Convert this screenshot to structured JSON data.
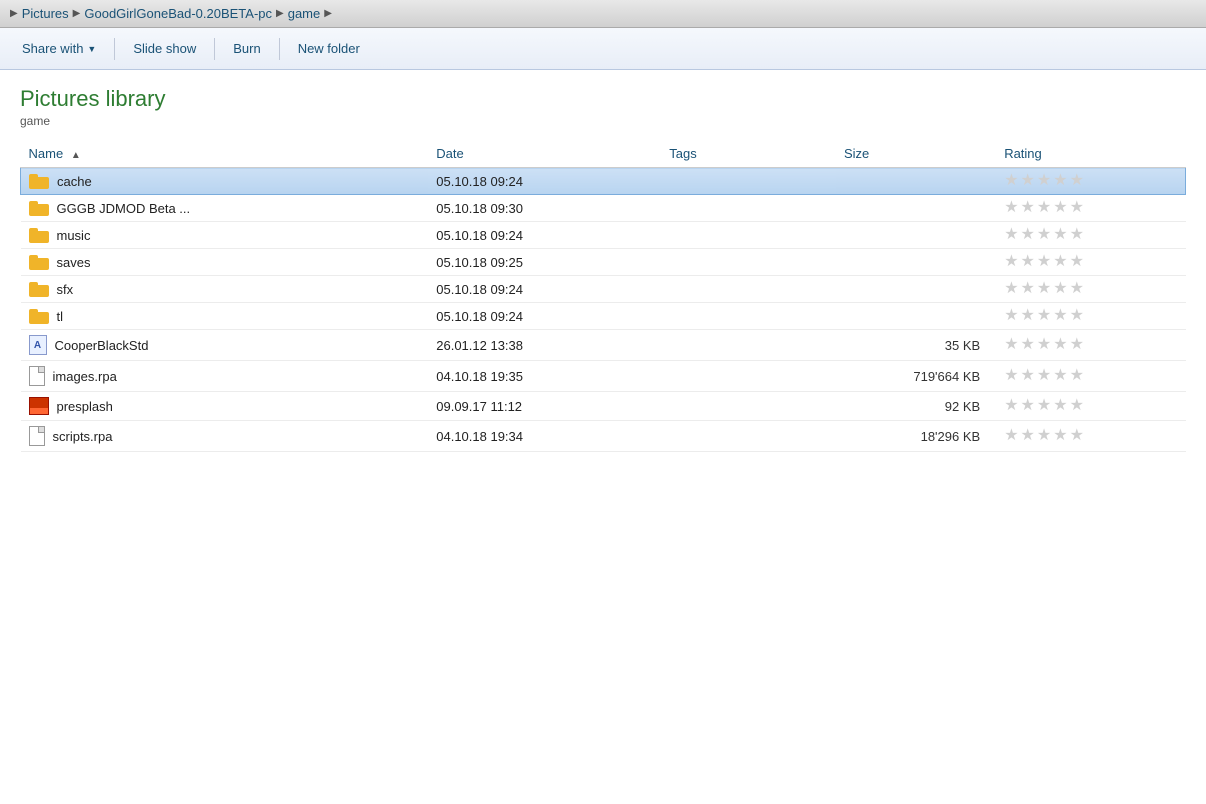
{
  "breadcrumb": {
    "items": [
      {
        "label": "Pictures"
      },
      {
        "label": "GoodGirlGoneBad-0.20BETA-pc"
      },
      {
        "label": "game"
      }
    ]
  },
  "toolbar": {
    "share_with_label": "Share with",
    "slideshow_label": "Slide show",
    "burn_label": "Burn",
    "new_folder_label": "New folder"
  },
  "library": {
    "title": "Pictures library",
    "subtitle": "game"
  },
  "table": {
    "columns": {
      "name": "Name",
      "date": "Date",
      "tags": "Tags",
      "size": "Size",
      "rating": "Rating"
    },
    "rows": [
      {
        "name": "cache",
        "type": "folder",
        "date": "05.10.18 09:24",
        "tags": "",
        "size": "",
        "selected": true
      },
      {
        "name": "GGGB JDMOD Beta ...",
        "type": "folder",
        "date": "05.10.18 09:30",
        "tags": "",
        "size": "",
        "selected": false
      },
      {
        "name": "music",
        "type": "folder",
        "date": "05.10.18 09:24",
        "tags": "",
        "size": "",
        "selected": false
      },
      {
        "name": "saves",
        "type": "folder",
        "date": "05.10.18 09:25",
        "tags": "",
        "size": "",
        "selected": false
      },
      {
        "name": "sfx",
        "type": "folder",
        "date": "05.10.18 09:24",
        "tags": "",
        "size": "",
        "selected": false
      },
      {
        "name": "tl",
        "type": "folder",
        "date": "05.10.18 09:24",
        "tags": "",
        "size": "",
        "selected": false
      },
      {
        "name": "CooperBlackStd",
        "type": "font",
        "date": "26.01.12 13:38",
        "tags": "",
        "size": "35 KB",
        "selected": false
      },
      {
        "name": "images.rpa",
        "type": "file",
        "date": "04.10.18 19:35",
        "tags": "",
        "size": "719'664 KB",
        "selected": false
      },
      {
        "name": "presplash",
        "type": "image",
        "date": "09.09.17 11:12",
        "tags": "",
        "size": "92 KB",
        "selected": false
      },
      {
        "name": "scripts.rpa",
        "type": "file",
        "date": "04.10.18 19:34",
        "tags": "",
        "size": "18'296 KB",
        "selected": false
      }
    ]
  }
}
